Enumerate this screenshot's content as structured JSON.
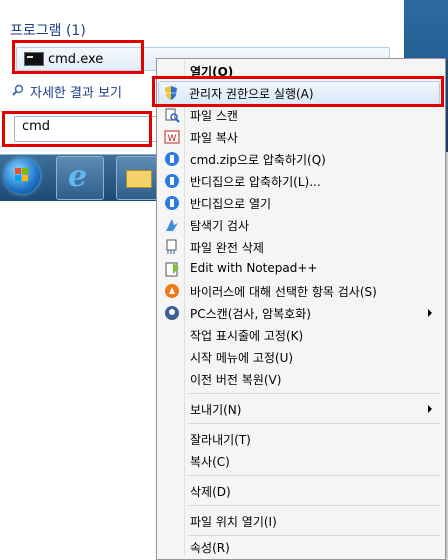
{
  "start_menu": {
    "section_title": "프로그램 (1)",
    "result_item": "cmd.exe",
    "see_more": "자세한 결과 보기",
    "search_value": "cmd"
  },
  "context_menu": {
    "items": [
      {
        "label": "열기(O)",
        "icon": "none",
        "bold": true
      },
      {
        "label": "관리자 권한으로 실행(A)",
        "icon": "uac-shield-icon"
      },
      {
        "label": "파일 스캔",
        "icon": "scan-icon"
      },
      {
        "label": "파일 복사",
        "icon": "copy-icon"
      },
      {
        "label": "cmd.zip으로 압축하기(Q)",
        "icon": "bandizip-icon"
      },
      {
        "label": "반디집으로 압축하기(L)...",
        "icon": "bandizip-icon"
      },
      {
        "label": "반디집으로 열기",
        "icon": "bandizip-icon"
      },
      {
        "label": "탐색기 검사",
        "icon": "explorer-scan-icon"
      },
      {
        "label": "파일 완전 삭제",
        "icon": "shred-icon"
      },
      {
        "label": "Edit with Notepad++",
        "icon": "notepadpp-icon"
      },
      {
        "label": "바이러스에 대해 선택한 항목 검사(S)",
        "icon": "avast-icon"
      },
      {
        "label": "PC스캔(검사, 암복호화)",
        "icon": "pcscan-icon",
        "submenu": true
      },
      {
        "label": "작업 표시줄에 고정(K)",
        "icon": "none"
      },
      {
        "label": "시작 메뉴에 고정(U)",
        "icon": "none"
      },
      {
        "label": "이전 버전 복원(V)",
        "icon": "none"
      },
      {
        "label": "보내기(N)",
        "icon": "none",
        "submenu": true
      },
      {
        "label": "잘라내기(T)",
        "icon": "none"
      },
      {
        "label": "복사(C)",
        "icon": "none"
      },
      {
        "label": "삭제(D)",
        "icon": "none"
      },
      {
        "label": "파일 위치 열기(I)",
        "icon": "none"
      },
      {
        "label": "속성(R)",
        "icon": "none"
      }
    ]
  },
  "colors": {
    "highlight": "#e50000",
    "hover_bg": "#dbe8f8",
    "accent_blue": "#1e3f8b"
  }
}
